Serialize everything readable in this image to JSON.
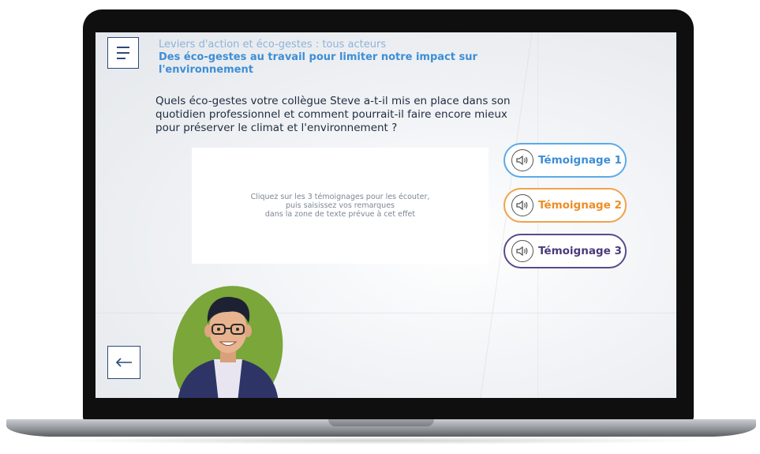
{
  "header": {
    "subtitle": "Leviers d'action et éco-gestes : tous acteurs",
    "title": "Des éco-gestes au travail pour limiter notre impact sur l'environnement"
  },
  "question": "Quels éco-gestes votre collègue Steve a-t-il mis en place dans son quotidien professionnel et comment pourrait-il faire encore mieux pour préserver le climat et l'environnement ?",
  "instructions": {
    "line1": "Cliquez sur les 3 témoignages pour les écouter,",
    "line2": "puis saisissez vos remarques",
    "line3": "dans la zone de texte prévue à cet effet"
  },
  "testimonials": [
    {
      "label": "Témoignage 1",
      "color": "#3d8ed6"
    },
    {
      "label": "Témoignage 2",
      "color": "#ee8e25"
    },
    {
      "label": "Témoignage 3",
      "color": "#4a3a7a"
    }
  ],
  "icons": {
    "menu": "hamburger-menu-icon",
    "back": "arrow-left-icon",
    "speaker": "speaker-icon"
  },
  "colors": {
    "accent": "#3d8ed6",
    "navy": "#2c4a78",
    "avatar_bg": "#7aa63a"
  }
}
